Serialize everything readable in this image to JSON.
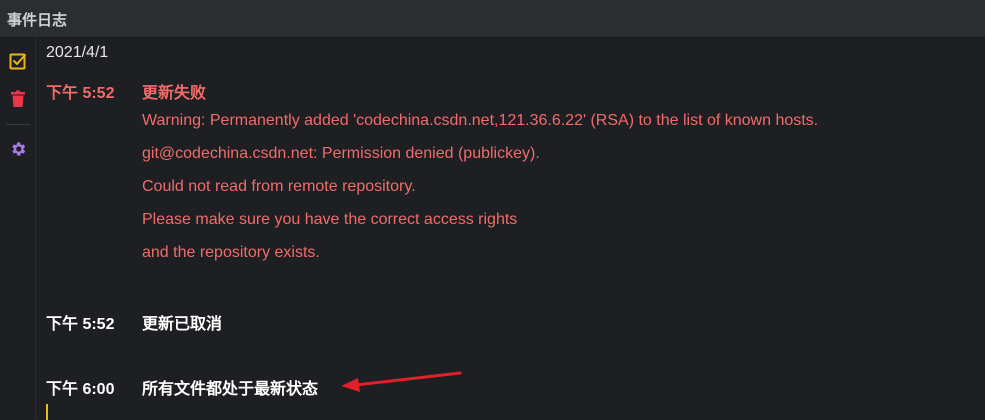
{
  "window": {
    "title": "事件日志"
  },
  "toolbar": {
    "items": [
      {
        "icon": "checkbox-check-icon",
        "color": "#e8b51f"
      },
      {
        "icon": "trash-icon",
        "color": "#e8364a"
      },
      {
        "icon": "gear-icon",
        "color": "#a879e8"
      }
    ]
  },
  "log": {
    "date": "2021/4/1",
    "entries": [
      {
        "time": "下午 5:52",
        "message": "更新失败",
        "status": "error",
        "details": [
          "Warning: Permanently added 'codechina.csdn.net,121.36.6.22' (RSA) to the list of known hosts.",
          "git@codechina.csdn.net: Permission denied (publickey).",
          "Could not read from remote repository.",
          "Please make sure you have the correct access rights",
          "and the repository exists."
        ]
      },
      {
        "time": "下午 5:52",
        "message": "更新已取消",
        "status": "info",
        "details": []
      },
      {
        "time": "下午 6:00",
        "message": "所有文件都处于最新状态",
        "status": "info",
        "details": []
      }
    ]
  },
  "colors": {
    "error": "#f26b6b",
    "annotation_arrow": "#e0202a",
    "caret": "#e5c01a"
  }
}
